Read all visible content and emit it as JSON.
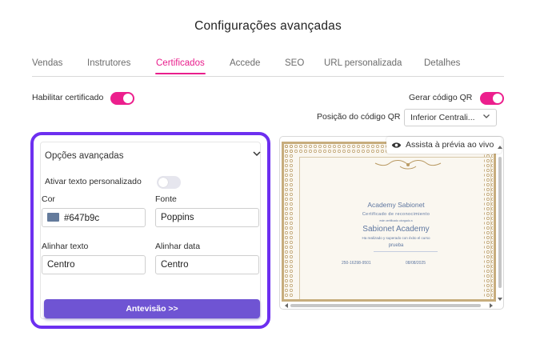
{
  "dialog": {
    "title": "Configurações avançadas"
  },
  "tabs": [
    {
      "label": "Vendas",
      "active": false
    },
    {
      "label": "Instrutores",
      "active": false
    },
    {
      "label": "Certificados",
      "active": true
    },
    {
      "label": "Accede",
      "active": false
    },
    {
      "label": "SEO",
      "active": false
    },
    {
      "label": "URL personalizada",
      "active": false
    },
    {
      "label": "Detalhes",
      "active": false
    }
  ],
  "settings": {
    "enable_certificate_label": "Habilitar certificado",
    "enable_certificate_on": true,
    "qr_label": "Gerar código QR",
    "qr_on": true,
    "qr_position_label": "Posição do código QR",
    "qr_position_value": "Inferior Centrali..."
  },
  "advanced": {
    "header": "Opções avançadas",
    "custom_text_label": "Ativar texto personalizado",
    "custom_text_on": false,
    "color_label": "Cor",
    "color_value": "#647b9c",
    "font_label": "Fonte",
    "font_value": "Poppins",
    "text_align_label": "Alinhar texto",
    "text_align_value": "Centro",
    "date_align_label": "Alinhar data",
    "date_align_value": "Centro",
    "preview_button": "Antevisão >>"
  },
  "preview": {
    "live_button": "Assista à prévia ao vivo",
    "certificate": {
      "academy": "Academy Sabionet",
      "subtitle": "Certificado de reconocimiento",
      "small_line": "este certificado otorgado a",
      "name": "Sabionet Academy",
      "completion": "Ha realizado y superado con éxito el curso",
      "course": "prueba",
      "code": "250-16298-9501",
      "date": "08/08/2025"
    }
  },
  "colors": {
    "accent_pink": "#e91e8c",
    "highlight_purple": "#6d2ff0",
    "button_purple": "#6f54d3",
    "swatch": "#647b9c"
  },
  "icons": {
    "chevron": "chevron-down-icon",
    "eye": "eye-icon"
  }
}
